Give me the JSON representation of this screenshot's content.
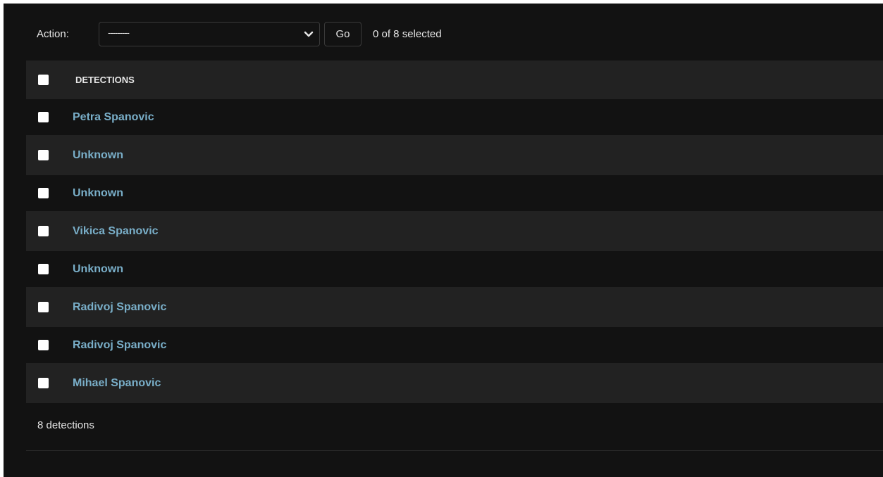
{
  "actions": {
    "label": "Action:",
    "select_value": "---------",
    "go_label": "Go",
    "selection_counter": "0 of 8 selected"
  },
  "table": {
    "header": "Detections",
    "rows": [
      {
        "name": "Petra Spanovic"
      },
      {
        "name": "Unknown"
      },
      {
        "name": "Unknown"
      },
      {
        "name": "Vikica Spanovic"
      },
      {
        "name": "Unknown"
      },
      {
        "name": "Radivoj Spanovic"
      },
      {
        "name": "Radivoj Spanovic"
      },
      {
        "name": "Mihael Spanovic"
      }
    ]
  },
  "footer": {
    "count_label": "8 detections"
  },
  "colors": {
    "background": "#121212",
    "row_alt": "#222222",
    "link": "#79aec8",
    "text": "#e6e6e6"
  }
}
